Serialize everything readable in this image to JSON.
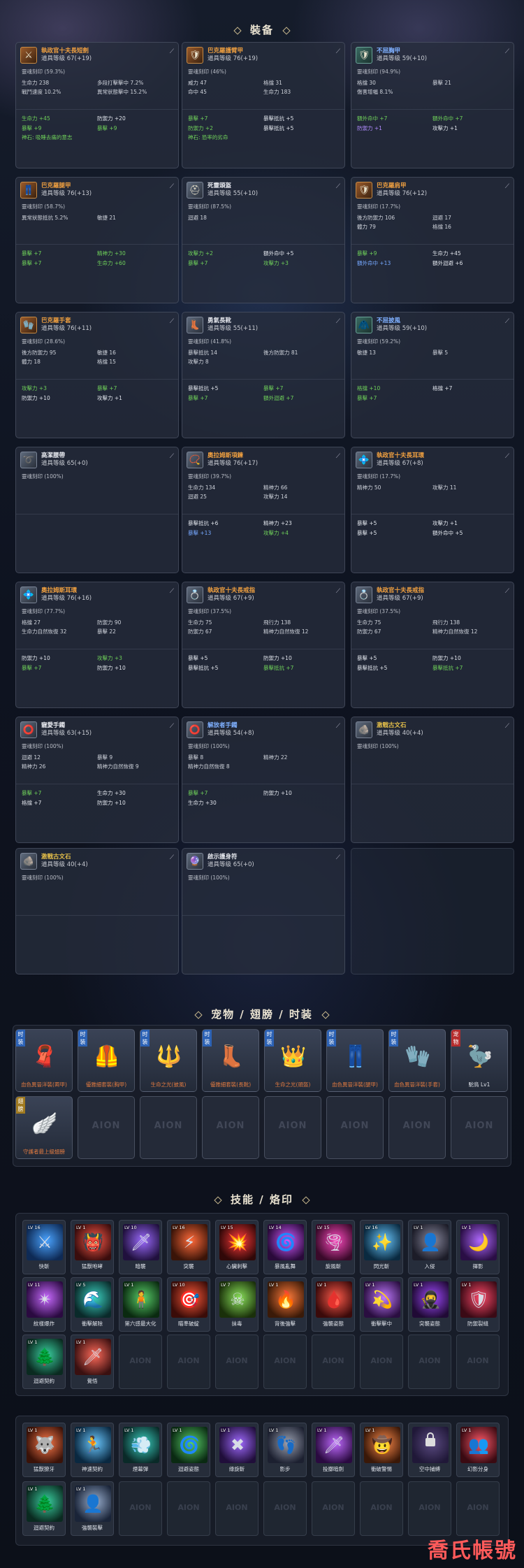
{
  "sections": {
    "equipment": "裝备",
    "pets": "宠物 / 翅膀 / 时装",
    "skills": "技能 / 烙印"
  },
  "equipment": [
    {
      "name": "執政官十夫長短劍",
      "name_color": "o",
      "level": "道具等级  67(+19)",
      "icon": "sword-icon",
      "glyph": "⚔",
      "bg": "o",
      "soul": "靈魂刻印 (59.3%)",
      "rows": [
        [
          "生命力  238",
          "多段打擊擊中  7.2%"
        ],
        [
          "戰鬥速度  10.2%",
          "異常狀態擊中  15.2%"
        ]
      ],
      "subs": [
        [
          "生命力 +45",
          "防禦力 +20",
          "g",
          "w"
        ],
        [
          "暴擊 +9",
          "暴擊 +9",
          "g",
          "g"
        ]
      ],
      "extra": "神石: 吸睡去痛的意志"
    },
    {
      "name": "巴克羅護臂甲",
      "name_color": "o",
      "level": "道具等级  76(+19)",
      "icon": "armor-icon",
      "glyph": "🛡",
      "bg": "o",
      "soul": "靈魂刻印 (46%)",
      "rows": [
        [
          "威力  47",
          "格擋  31"
        ],
        [
          "命中  45",
          "生命力  183"
        ]
      ],
      "subs": [
        [
          "暴擊 +7",
          "暴擊抵抗 +5",
          "g",
          "w"
        ],
        [
          "防禦力 +2",
          "暴擊抵抗 +5",
          "g",
          "w"
        ]
      ],
      "extra": "神石: 恐率的劣命"
    },
    {
      "name": "不屈胸甲",
      "name_color": "b",
      "level": "道具等级  59(+10)",
      "icon": "chest-armor-icon",
      "glyph": "🛡",
      "bg": "t",
      "soul": "靈魂刻印 (94.9%)",
      "rows": [
        [
          "格擋  30",
          "暴擊  21"
        ],
        [
          "傷害增幅  8.1%",
          ""
        ]
      ],
      "subs": [
        [
          "額外命中 +7",
          "額外命中 +7",
          "g",
          "g"
        ],
        [
          "防禦力 +1",
          "攻擊力 +1",
          "p",
          "w"
        ]
      ],
      "extra": ""
    },
    {
      "name": "巴克羅腿甲",
      "name_color": "o",
      "level": "道具等级  76(+13)",
      "icon": "leg-armor-icon",
      "glyph": "👖",
      "bg": "o",
      "soul": "靈魂刻印 (58.7%)",
      "rows": [
        [
          "異常狀態抵抗  5.2%",
          "敏捷  21"
        ]
      ],
      "subs": [
        [
          "暴擊 +7",
          "精神力 +30",
          "g",
          "g"
        ],
        [
          "暴擊 +7",
          "生命力 +60",
          "g",
          "g"
        ]
      ],
      "extra": ""
    },
    {
      "name": "死靈頭盔",
      "name_color": "w",
      "level": "道具等级  55(+10)",
      "icon": "helmet-icon",
      "glyph": "⛑",
      "bg": "",
      "soul": "靈魂刻印 (87.5%)",
      "rows": [
        [
          "迴避  18",
          ""
        ]
      ],
      "subs": [
        [
          "攻擊力 +2",
          "額外命中 +5",
          "g",
          "w"
        ],
        [
          "暴擊 +7",
          "攻擊力 +3",
          "g",
          "g"
        ]
      ],
      "extra": ""
    },
    {
      "name": "巴克羅肩甲",
      "name_color": "o",
      "level": "道具等级  76(+12)",
      "icon": "shoulder-armor-icon",
      "glyph": "🛡",
      "bg": "o",
      "soul": "靈魂刻印 (17.7%)",
      "rows": [
        [
          "後方防禦力  106",
          "迴避  17"
        ],
        [
          "體力  79",
          "格擋  16"
        ]
      ],
      "subs": [
        [
          "暴擊 +9",
          "生命力 +45",
          "g",
          "w"
        ],
        [
          "額外命中 +13",
          "額外迴避 +6",
          "bl",
          "w"
        ]
      ],
      "extra": ""
    },
    {
      "name": "巴克羅手套",
      "name_color": "o",
      "level": "道具等级  76(+11)",
      "icon": "gloves-icon",
      "glyph": "🧤",
      "bg": "o",
      "soul": "靈魂刻印 (28.6%)",
      "rows": [
        [
          "後方防禦力  95",
          "敏捷  16"
        ],
        [
          "體力  18",
          "格擋  15"
        ]
      ],
      "subs": [
        [
          "攻擊力 +3",
          "暴擊 +7",
          "g",
          "g"
        ],
        [
          "防禦力 +10",
          "攻擊力 +1",
          "w",
          "w"
        ]
      ],
      "extra": ""
    },
    {
      "name": "勇氣長靴",
      "name_color": "w",
      "level": "道具等级  55(+11)",
      "icon": "boots-icon",
      "glyph": "👢",
      "bg": "",
      "soul": "靈魂刻印 (41.8%)",
      "rows": [
        [
          "暴擊抵抗  14",
          "後方防禦力  81"
        ],
        [
          "攻擊力  8",
          ""
        ]
      ],
      "subs": [
        [
          "暴擊抵抗 +5",
          "暴擊 +7",
          "w",
          "g"
        ],
        [
          "暴擊 +7",
          "額外迴避 +7",
          "g",
          "g"
        ]
      ],
      "extra": ""
    },
    {
      "name": "不屈披風",
      "name_color": "b",
      "level": "道具等级  59(+10)",
      "icon": "cape-icon",
      "glyph": "🧥",
      "bg": "t",
      "soul": "靈魂刻印 (59.2%)",
      "rows": [
        [
          "敏捷  13",
          "暴擊  5"
        ]
      ],
      "subs": [
        [
          "格擋 +10",
          "格擋 +7",
          "g",
          "w"
        ],
        [
          "暴擊 +7",
          "",
          "g",
          "w"
        ]
      ],
      "extra": ""
    },
    {
      "name": "高潔腰帶",
      "name_color": "w",
      "level": "道具等级  65(+0)",
      "icon": "belt-icon",
      "glyph": "➰",
      "bg": "",
      "soul": "靈魂刻印 (100%)",
      "rows": [],
      "subs": [],
      "extra": ""
    },
    {
      "name": "奧拉姆斯項鍊",
      "name_color": "o",
      "level": "道具等级  76(+17)",
      "icon": "necklace-icon",
      "glyph": "📿",
      "bg": "",
      "soul": "靈魂刻印 (39.7%)",
      "rows": [
        [
          "生命力  134",
          "精神力  66"
        ],
        [
          "迴避  25",
          "攻擊力  14"
        ]
      ],
      "subs": [
        [
          "暴擊抵抗 +6",
          "精神力 +23",
          "w",
          "w"
        ],
        [
          "暴擊 +13",
          "攻擊力 +4",
          "bl",
          "g"
        ]
      ],
      "extra": ""
    },
    {
      "name": "執政官十夫長耳環",
      "name_color": "o",
      "level": "道具等级  67(+8)",
      "icon": "earring-icon",
      "glyph": "💠",
      "bg": "",
      "soul": "靈魂刻印 (17.7%)",
      "rows": [
        [
          "精神力  50",
          "攻擊力  11"
        ]
      ],
      "subs": [
        [
          "暴擊 +5",
          "攻擊力 +1",
          "w",
          "w"
        ],
        [
          "暴擊 +5",
          "額外命中 +5",
          "w",
          "w"
        ]
      ],
      "extra": ""
    },
    {
      "name": "奧拉姆斯耳環",
      "name_color": "o",
      "level": "道具等级  76(+16)",
      "icon": "earring-icon",
      "glyph": "💠",
      "bg": "",
      "soul": "靈魂刻印 (77.7%)",
      "rows": [
        [
          "格擋  27",
          "防禦力  90"
        ],
        [
          "生命力自然恢復  32",
          "暴擊  22"
        ]
      ],
      "subs": [
        [
          "防禦力 +10",
          "攻擊力 +3",
          "w",
          "g"
        ],
        [
          "暴擊 +7",
          "防禦力 +10",
          "g",
          "w"
        ]
      ],
      "extra": ""
    },
    {
      "name": "執政官十夫長戒指",
      "name_color": "o",
      "level": "道具等级  67(+9)",
      "icon": "ring-icon",
      "glyph": "💍",
      "bg": "",
      "soul": "靈魂刻印 (37.5%)",
      "rows": [
        [
          "生命力  75",
          "飛行力  138"
        ],
        [
          "防禦力  67",
          "精神力自然恢復  12"
        ]
      ],
      "subs": [
        [
          "暴擊 +5",
          "防禦力 +10",
          "w",
          "w"
        ],
        [
          "暴擊抵抗 +5",
          "暴擊抵抗 +7",
          "w",
          "g"
        ]
      ],
      "extra": ""
    },
    {
      "name": "執政官十夫長戒指",
      "name_color": "o",
      "level": "道具等级  67(+9)",
      "icon": "ring-icon",
      "glyph": "💍",
      "bg": "",
      "soul": "靈魂刻印 (37.5%)",
      "rows": [
        [
          "生命力  75",
          "飛行力  138"
        ],
        [
          "防禦力  67",
          "精神力自然恢復  12"
        ]
      ],
      "subs": [
        [
          "暴擊 +5",
          "防禦力 +10",
          "w",
          "w"
        ],
        [
          "暴擊抵抗 +5",
          "暴擊抵抗 +7",
          "w",
          "g"
        ]
      ],
      "extra": ""
    },
    {
      "name": "寵愛手鐲",
      "name_color": "w",
      "level": "道具等级  63(+15)",
      "icon": "bracelet-icon",
      "glyph": "⭕",
      "bg": "",
      "soul": "靈魂刻印 (100%)",
      "rows": [
        [
          "迴避  12",
          "暴擊  9"
        ],
        [
          "精神力  26",
          "精神力自然恢復  9"
        ]
      ],
      "subs": [
        [
          "暴擊 +7",
          "生命力 +30",
          "g",
          "w"
        ],
        [
          "格擋 +7",
          "防禦力 +10",
          "w",
          "w"
        ]
      ],
      "extra": ""
    },
    {
      "name": "解放者手鐲",
      "name_color": "b",
      "level": "道具等级  54(+8)",
      "icon": "bracelet-icon",
      "glyph": "⭕",
      "bg": "",
      "soul": "靈魂刻印 (100%)",
      "rows": [
        [
          "暴擊  8",
          "精神力  22"
        ],
        [
          "精神力自然恢復  8",
          ""
        ]
      ],
      "subs": [
        [
          "暴擊 +7",
          "防禦力 +10",
          "g",
          "w"
        ],
        [
          "生命力 +30",
          "",
          "w",
          "w"
        ]
      ],
      "extra": ""
    },
    {
      "name": "激戰古文石",
      "name_color": "y",
      "level": "道具等级  40(+4)",
      "icon": "rune-stone-icon",
      "glyph": "🪨",
      "bg": "",
      "soul": "靈魂刻印 (100%)",
      "rows": [],
      "subs": [],
      "extra": ""
    },
    {
      "name": "激戰古文石",
      "name_color": "y",
      "level": "道具等级  40(+4)",
      "icon": "rune-stone-icon",
      "glyph": "🪨",
      "bg": "",
      "soul": "靈魂刻印 (100%)",
      "rows": [],
      "subs": [],
      "extra": ""
    },
    {
      "name": "啟示護身符",
      "name_color": "w",
      "level": "道具等级  65(+0)",
      "icon": "amulet-icon",
      "glyph": "🔮",
      "bg": "",
      "soul": "靈魂刻印 (100%)",
      "rows": [],
      "subs": [],
      "extra": ""
    }
  ],
  "fashion": [
    {
      "tag": "时装",
      "tag_color": "",
      "glyph": "🧣",
      "caption": "血色異晉洋裝(兩甲)",
      "cap_color": ""
    },
    {
      "tag": "时装",
      "tag_color": "",
      "glyph": "🦺",
      "caption": "優雅細套裝(胸甲)",
      "cap_color": ""
    },
    {
      "tag": "时装",
      "tag_color": "",
      "glyph": "🔱",
      "caption": "生命之光(披風)",
      "cap_color": ""
    },
    {
      "tag": "时装",
      "tag_color": "",
      "glyph": "👢",
      "caption": "優雅細套裝(長靴)",
      "cap_color": ""
    },
    {
      "tag": "时装",
      "tag_color": "",
      "glyph": "👑",
      "caption": "生命之光(頭盔)",
      "cap_color": ""
    },
    {
      "tag": "时装",
      "tag_color": "",
      "glyph": "👖",
      "caption": "血色異晉洋裝(腿甲)",
      "cap_color": ""
    },
    {
      "tag": "时装",
      "tag_color": "",
      "glyph": "🧤",
      "caption": "血色異晉洋裝(手套)",
      "cap_color": ""
    },
    {
      "tag": "宠物",
      "tag_color": "r",
      "glyph": "🦤",
      "caption": "駝鳥 Lv1",
      "cap_color": "w"
    },
    {
      "tag": "翅膀",
      "tag_color": "y",
      "glyph": "🪽",
      "caption": "守護者最上級翅膀",
      "cap_color": ""
    }
  ],
  "skills1": [
    {
      "lv": "LV 16",
      "name": "快斬",
      "c1": "#4aa3ff",
      "c2": "#0e2a55",
      "glyph": "⚔"
    },
    {
      "lv": "LV 1",
      "name": "猛獸咆哮",
      "c1": "#ff5a4a",
      "c2": "#3a0d0d",
      "glyph": "👹"
    },
    {
      "lv": "LV 10",
      "name": "暗襲",
      "c1": "#9c6bff",
      "c2": "#20103d",
      "glyph": "🗡"
    },
    {
      "lv": "LV 16",
      "name": "突襲",
      "c1": "#ff6a3a",
      "c2": "#3a1408",
      "glyph": "⚡"
    },
    {
      "lv": "LV 15",
      "name": "心臟刺擊",
      "c1": "#ff3a3a",
      "c2": "#300808",
      "glyph": "💥"
    },
    {
      "lv": "LV 14",
      "name": "暴風亂舞",
      "c1": "#d05aff",
      "c2": "#2a0a3a",
      "glyph": "🌀"
    },
    {
      "lv": "LV 15",
      "name": "旋風斬",
      "c1": "#ff4ac0",
      "c2": "#3a0a2a",
      "glyph": "🌪"
    },
    {
      "lv": "LV 16",
      "name": "閃光斬",
      "c1": "#6ac8ff",
      "c2": "#0a2a40",
      "glyph": "✨"
    },
    {
      "lv": "LV 1",
      "name": "入侵",
      "c1": "#8a8aa0",
      "c2": "#1c1c28",
      "glyph": "👤"
    },
    {
      "lv": "LV 1",
      "name": "擇影",
      "c1": "#b06aff",
      "c2": "#2a0e45",
      "glyph": "🌙"
    },
    {
      "lv": "LV 11",
      "name": "紋樣爆炸",
      "c1": "#c86aff",
      "c2": "#2a0a40",
      "glyph": "✴"
    },
    {
      "lv": "LV 5",
      "name": "衝擊解除",
      "c1": "#3ad0c0",
      "c2": "#0a2a2a",
      "glyph": "🌊"
    },
    {
      "lv": "LV 1",
      "name": "第六感最大化",
      "c1": "#5ad06a",
      "c2": "#0a2a10",
      "glyph": "🧍"
    },
    {
      "lv": "LV 10",
      "name": "瞄準破綻",
      "c1": "#ff5a3a",
      "c2": "#3a0c08",
      "glyph": "🎯"
    },
    {
      "lv": "LV 7",
      "name": "抹毒",
      "c1": "#8ae05a",
      "c2": "#1a300a",
      "glyph": "☠"
    },
    {
      "lv": "LV 1",
      "name": "背後強擊",
      "c1": "#ff7a3a",
      "c2": "#3a1a08",
      "glyph": "🔥"
    },
    {
      "lv": "LV 1",
      "name": "強襲姿態",
      "c1": "#ff5a4a",
      "c2": "#3a0a0a",
      "glyph": "🩸"
    },
    {
      "lv": "LV 1",
      "name": "衝擊擊中",
      "c1": "#c07aff",
      "c2": "#2a0e40",
      "glyph": "💫"
    },
    {
      "lv": "LV 1",
      "name": "突襲姿態",
      "c1": "#a04aff",
      "c2": "#200a35",
      "glyph": "🥷"
    },
    {
      "lv": "LV 1",
      "name": "防禦裂縫",
      "c1": "#ff4a6a",
      "c2": "#3a0a15",
      "glyph": "🛡"
    },
    {
      "lv": "LV 1",
      "name": "迴避契約",
      "c1": "#3ad0a0",
      "c2": "#0a2a20",
      "glyph": "🌲"
    },
    {
      "lv": "LV 1",
      "name": "覺悟",
      "c1": "#ff6a5a",
      "c2": "#3a1010",
      "glyph": "🗡"
    }
  ],
  "skills2": [
    {
      "lv": "LV 1",
      "name": "猛獸獠牙",
      "c1": "#ff7a4a",
      "c2": "#3a1208",
      "glyph": "🐺",
      "lock": false
    },
    {
      "lv": "LV 1",
      "name": "神速契約",
      "c1": "#6ac8ff",
      "c2": "#0a2840",
      "glyph": "🏃",
      "lock": false
    },
    {
      "lv": "LV 1",
      "name": "煙幕彈",
      "c1": "#3ad0c0",
      "c2": "#0a2a28",
      "glyph": "💨",
      "lock": false
    },
    {
      "lv": "LV 1",
      "name": "迴避姿態",
      "c1": "#5ad06a",
      "c2": "#0a2a12",
      "glyph": "🌀",
      "lock": false
    },
    {
      "lv": "LV 1",
      "name": "綠旋斬",
      "c1": "#a06aff",
      "c2": "#200e3a",
      "glyph": "✖",
      "lock": false
    },
    {
      "lv": "LV 1",
      "name": "影步",
      "c1": "#9aa0b0",
      "c2": "#1c2030",
      "glyph": "👣",
      "lock": false
    },
    {
      "lv": "LV 1",
      "name": "投擲暗劍",
      "c1": "#c06aff",
      "c2": "#2a0a40",
      "glyph": "🗡",
      "lock": false
    },
    {
      "lv": "LV 1",
      "name": "衝破警惕",
      "c1": "#ff8a4a",
      "c2": "#3a1808",
      "glyph": "🤠",
      "lock": false
    },
    {
      "lv": "",
      "name": "空中捕縛",
      "c1": "#5a4a80",
      "c2": "#201838",
      "glyph": "",
      "lock": true
    },
    {
      "lv": "LV 1",
      "name": "幻影分身",
      "c1": "#ff5a6a",
      "c2": "#3a0a12",
      "glyph": "👥",
      "lock": false
    },
    {
      "lv": "LV 1",
      "name": "迴避契約",
      "c1": "#3ad0a0",
      "c2": "#0a2a20",
      "glyph": "🌲",
      "lock": false
    },
    {
      "lv": "LV 1",
      "name": "強襲裝擊",
      "c1": "#9ab0d0",
      "c2": "#1a2438",
      "glyph": "👤",
      "lock": false
    }
  ],
  "watermark": "喬氏帳號",
  "empty_logo": "AION"
}
